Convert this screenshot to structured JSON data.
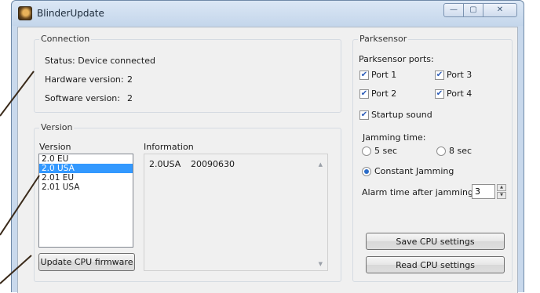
{
  "window": {
    "title": "BlinderUpdate",
    "minimize_label": "—",
    "maximize_label": "▢",
    "close_label": "✕"
  },
  "connection": {
    "title": "Connection",
    "status": "Status: Device connected",
    "hardware_label": "Hardware version:",
    "hardware_value": "2",
    "software_label": "Software version:",
    "software_value": "2"
  },
  "version": {
    "group_title": "Version",
    "list_header": "Version",
    "items": [
      "2.0 EU",
      "2.0 USA",
      "2.01 EU",
      "2.01 USA"
    ],
    "selected": "2.0 USA",
    "info_header": "Information",
    "info_name": "2.0USA",
    "info_date": "20090630",
    "update_button": "Update CPU firmware"
  },
  "parksensor": {
    "title": "Parksensor",
    "ports_label": "Parksensor ports:",
    "ports": [
      {
        "label": "Port 1",
        "checked": true
      },
      {
        "label": "Port 3",
        "checked": true
      },
      {
        "label": "Port 2",
        "checked": true
      },
      {
        "label": "Port 4",
        "checked": true
      }
    ],
    "startup_sound": {
      "label": "Startup sound",
      "checked": true
    },
    "jamming_label": "Jamming time:",
    "jamming_options": [
      {
        "label": "5 sec",
        "selected": false
      },
      {
        "label": "8 sec",
        "selected": false
      },
      {
        "label": "Constant Jamming",
        "selected": true
      }
    ],
    "alarm_label": "Alarm time after jamming:",
    "alarm_value": "3",
    "save_button": "Save CPU settings",
    "read_button": "Read CPU settings"
  },
  "colors": {
    "selection": "#3399ff",
    "callout_line": "#3a2a1a",
    "window_frame": "#c9d9ec"
  }
}
